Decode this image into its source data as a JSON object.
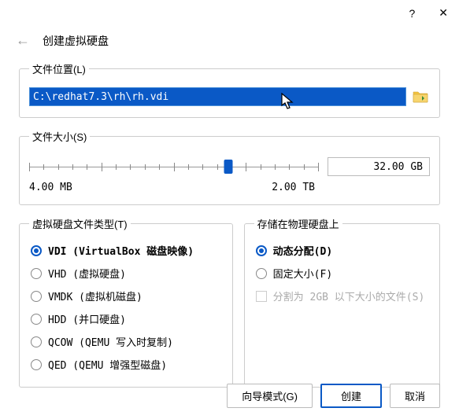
{
  "titlebar": {
    "help": "?",
    "close": "✕"
  },
  "header": {
    "back": "←",
    "title": "创建虚拟硬盘"
  },
  "fileLocation": {
    "legend": "文件位置(L)",
    "path": "C:\\redhat7.3\\rh\\rh.vdi"
  },
  "fileSize": {
    "legend": "文件大小(S)",
    "value": "32.00 GB",
    "min": "4.00 MB",
    "max": "2.00 TB",
    "thumbPercent": 69
  },
  "diskType": {
    "legend": "虚拟硬盘文件类型(T)",
    "options": [
      {
        "label": "VDI (VirtualBox 磁盘映像)",
        "selected": true
      },
      {
        "label": "VHD (虚拟硬盘)",
        "selected": false
      },
      {
        "label": "VMDK (虚拟机磁盘)",
        "selected": false
      },
      {
        "label": "HDD (并口硬盘)",
        "selected": false
      },
      {
        "label": "QCOW (QEMU 写入时复制)",
        "selected": false
      },
      {
        "label": "QED (QEMU 增强型磁盘)",
        "selected": false
      }
    ]
  },
  "storage": {
    "legend": "存储在物理硬盘上",
    "options": [
      {
        "label": "动态分配(D)",
        "selected": true
      },
      {
        "label": "固定大小(F)",
        "selected": false
      }
    ],
    "split": {
      "label": "分割为 2GB 以下大小的文件(S)",
      "disabled": true
    }
  },
  "footer": {
    "guideMode": "向导模式(G)",
    "create": "创建",
    "cancel": "取消"
  }
}
